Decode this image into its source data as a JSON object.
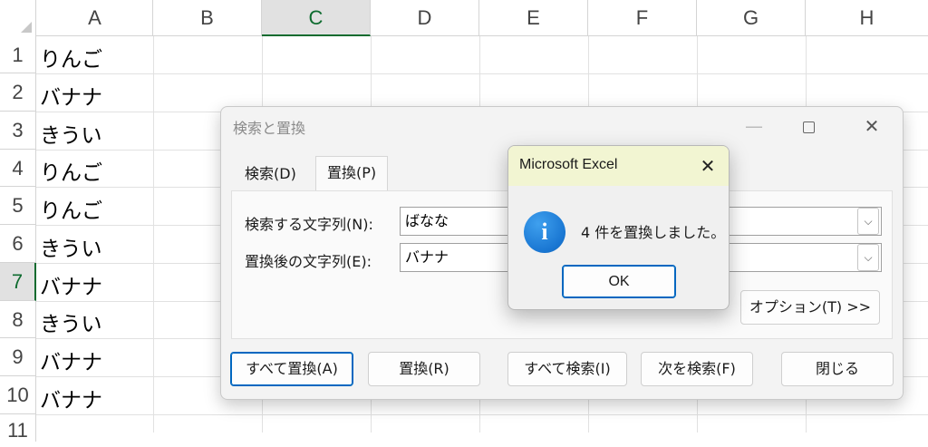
{
  "sheet": {
    "columns": [
      "A",
      "B",
      "C",
      "D",
      "E",
      "F",
      "G",
      "H"
    ],
    "active_column": "C",
    "rows": [
      "1",
      "2",
      "3",
      "4",
      "5",
      "6",
      "7",
      "8",
      "9",
      "10",
      "11"
    ],
    "active_row": "7",
    "column_a_values": [
      "りんご",
      "バナナ",
      "きうい",
      "りんご",
      "りんご",
      "きうい",
      "バナナ",
      "きうい",
      "バナナ",
      "バナナ"
    ]
  },
  "find_replace_dialog": {
    "title": "検索と置換",
    "minimize_glyph": "—",
    "close_glyph": "✕",
    "tabs": [
      {
        "label": "検索(D)",
        "selected": false
      },
      {
        "label": "置換(P)",
        "selected": true
      }
    ],
    "find_label": "検索する文字列(N):",
    "find_value": "ばなな",
    "replace_label": "置換後の文字列(E):",
    "replace_value": "バナナ",
    "options_button": "オプション(T) >>",
    "buttons": {
      "replace_all": "すべて置換(A)",
      "replace": "置換(R)",
      "find_all": "すべて検索(I)",
      "find_next": "次を検索(F)",
      "close": "閉じる"
    },
    "dropdown_glyph": "⌵"
  },
  "message_box": {
    "title": "Microsoft Excel",
    "close_glyph": "✕",
    "icon": "info-icon",
    "icon_glyph": "i",
    "message": "4 件を置換しました。",
    "ok_label": "OK"
  },
  "colors": {
    "accent_green": "#0e6b2f",
    "button_focus_blue": "#0067c0",
    "msgbox_titlebar": "#f2f5d2",
    "info_icon_blue": "#1976d2"
  }
}
